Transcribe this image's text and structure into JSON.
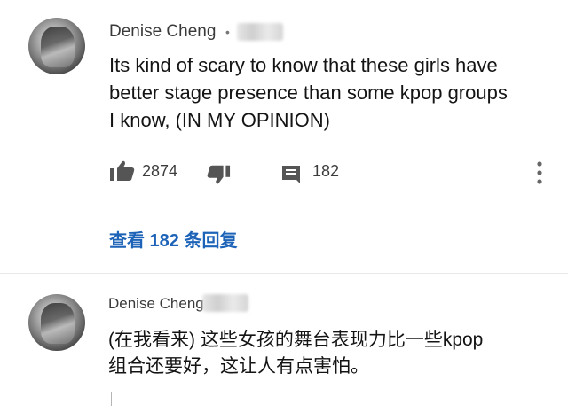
{
  "comments": [
    {
      "author": "Denise Cheng",
      "separator": "•",
      "text_lines": [
        "Its kind of scary to know that these girls have",
        "better stage presence than some kpop groups",
        "I know, (IN MY OPINION)"
      ],
      "likes": "2874",
      "reply_count": "182",
      "view_replies_label": "查看 182 条回复"
    },
    {
      "author": "Denise Cheng",
      "text_lines": [
        "(在我看来) 这些女孩的舞台表现力比一些kpop",
        "组合还要好，这让人有点害怕。"
      ]
    }
  ],
  "icons": [
    "thumbs-up-icon",
    "thumbs-down-icon",
    "comment-icon",
    "more-vert-icon"
  ],
  "colors": {
    "link": "#1d63b8",
    "text": "#141414",
    "meta": "#3c3c3c"
  }
}
